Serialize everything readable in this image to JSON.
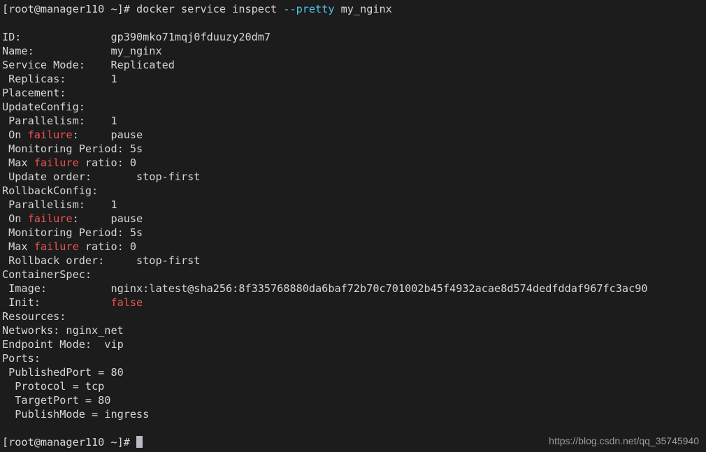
{
  "terminal": {
    "background_color": "#1c1c1c",
    "foreground_color": "#d6d6d6",
    "accent_red": "#ef5350",
    "accent_cyan": "#4fc3e8",
    "cursor_color": "#b8bac8",
    "prompt": "[root@manager110 ~]# ",
    "command_line": {
      "prompt": "[root@manager110 ~]# ",
      "command": "docker service inspect ",
      "flag": "--pretty",
      "argument": " my_nginx"
    },
    "final_prompt": "[root@manager110 ~]# ",
    "lines": [
      {
        "text": "ID:              gp390mko71mqj0fduuzy20dm7"
      },
      {
        "text": "Name:            my_nginx"
      },
      {
        "text": "Service Mode:    Replicated"
      },
      {
        "text": " Replicas:       1"
      },
      {
        "text": "Placement:"
      },
      {
        "text": "UpdateConfig:"
      },
      {
        "text": " Parallelism:    1"
      },
      {
        "pre": " On ",
        "red": "failure",
        "post": ":     pause"
      },
      {
        "text": " Monitoring Period: 5s"
      },
      {
        "pre": " Max ",
        "red": "failure",
        "post": " ratio: 0"
      },
      {
        "text": " Update order:       stop-first"
      },
      {
        "text": "RollbackConfig:"
      },
      {
        "text": " Parallelism:    1"
      },
      {
        "pre": " On ",
        "red": "failure",
        "post": ":     pause"
      },
      {
        "text": " Monitoring Period: 5s"
      },
      {
        "pre": " Max ",
        "red": "failure",
        "post": " ratio: 0"
      },
      {
        "text": " Rollback order:     stop-first"
      },
      {
        "text": "ContainerSpec:"
      },
      {
        "text": " Image:          nginx:latest@sha256:8f335768880da6baf72b70c701002b45f4932acae8d574dedfddaf967fc3ac90"
      },
      {
        "pre": " Init:           ",
        "red": "false",
        "post": ""
      },
      {
        "text": "Resources:"
      },
      {
        "text": "Networks: nginx_net"
      },
      {
        "text": "Endpoint Mode:  vip"
      },
      {
        "text": "Ports:"
      },
      {
        "text": " PublishedPort = 80"
      },
      {
        "text": "  Protocol = tcp"
      },
      {
        "text": "  TargetPort = 80"
      },
      {
        "text": "  PublishMode = ingress"
      }
    ]
  },
  "watermark": {
    "text": "https://blog.csdn.net/qq_35745940"
  }
}
